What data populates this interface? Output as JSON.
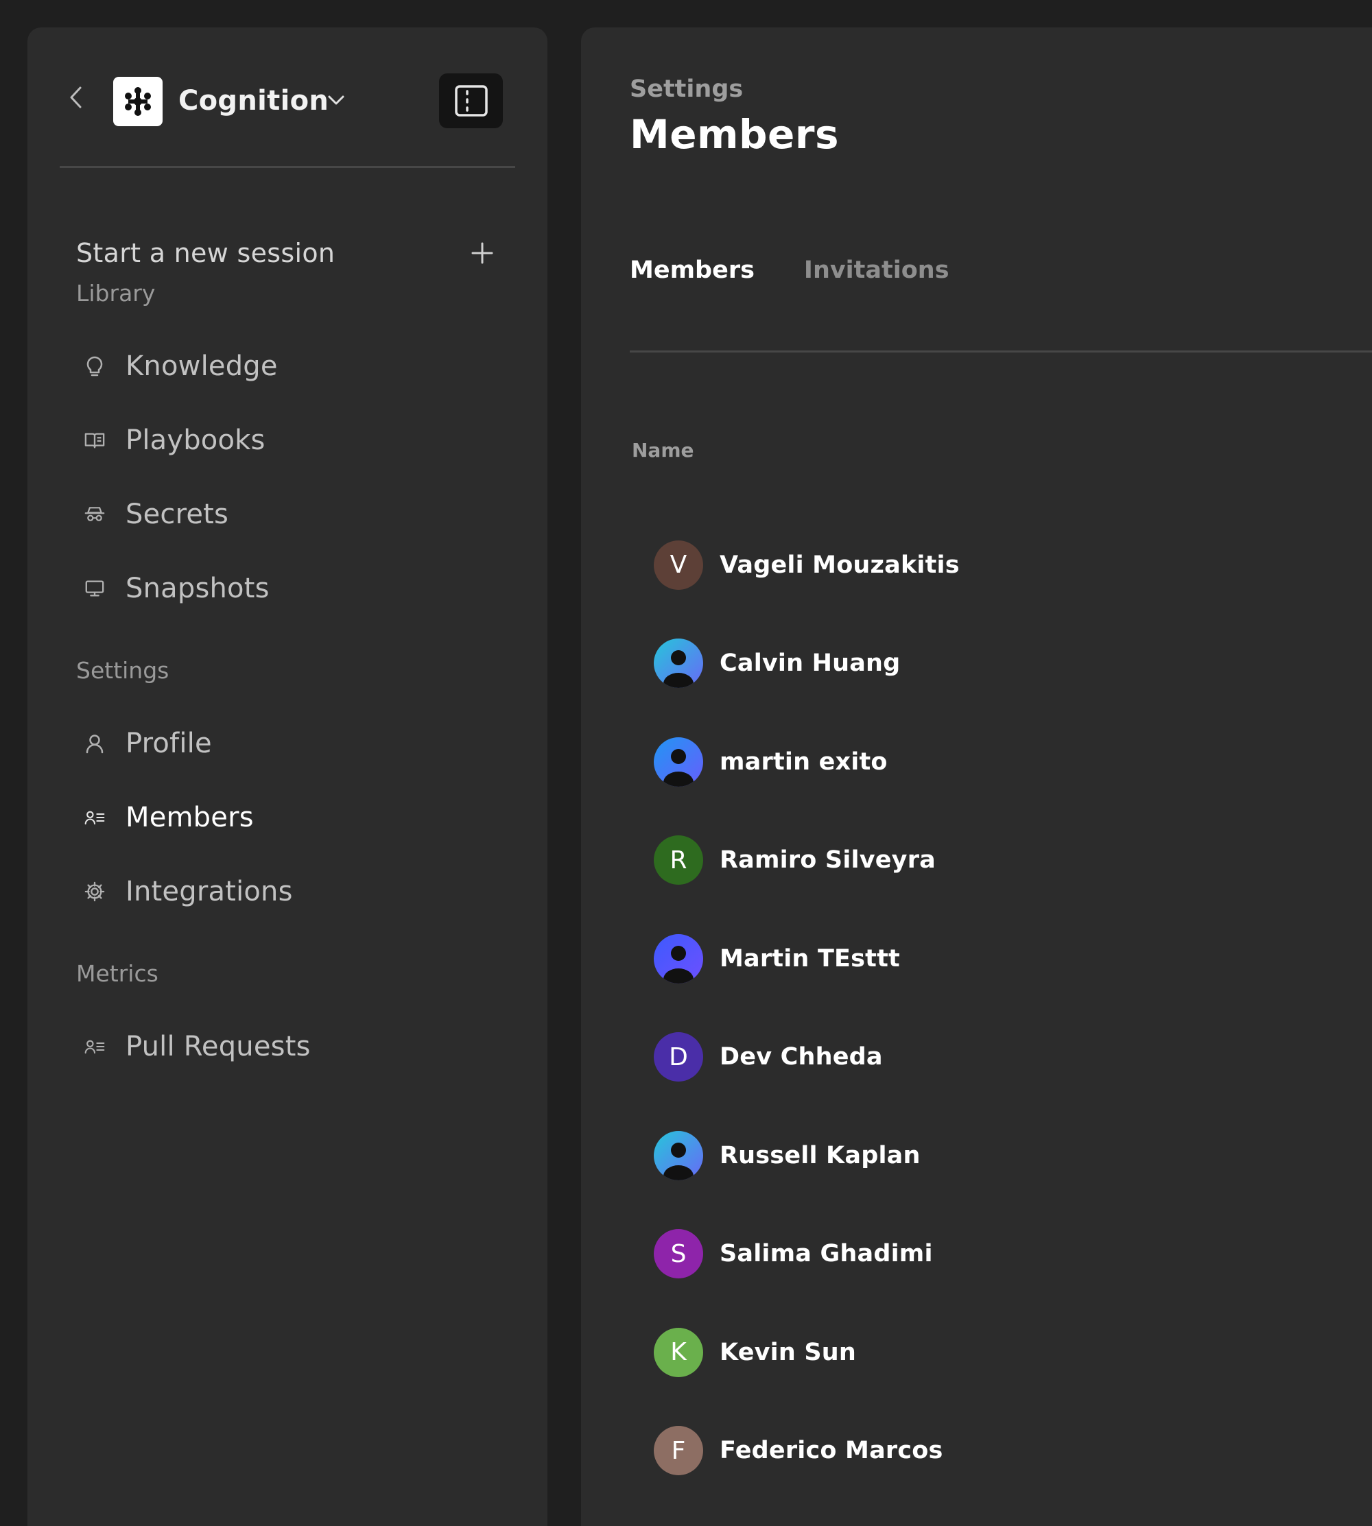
{
  "sidebar": {
    "org_name": "Cognition",
    "new_session_label": "Start a new session",
    "sections": {
      "library": "Library",
      "settings": "Settings",
      "metrics": "Metrics"
    },
    "library_items": [
      {
        "label": "Knowledge",
        "icon": "lightbulb-icon"
      },
      {
        "label": "Playbooks",
        "icon": "book-icon"
      },
      {
        "label": "Secrets",
        "icon": "incognito-icon"
      },
      {
        "label": "Snapshots",
        "icon": "monitor-icon"
      }
    ],
    "settings_items": [
      {
        "label": "Profile",
        "icon": "user-icon"
      },
      {
        "label": "Members",
        "icon": "members-icon",
        "active": true
      },
      {
        "label": "Integrations",
        "icon": "gear-icon"
      }
    ],
    "metrics_items": [
      {
        "label": "Pull Requests",
        "icon": "members-icon"
      }
    ]
  },
  "main": {
    "breadcrumb": "Settings",
    "title": "Members",
    "tabs": [
      {
        "label": "Members",
        "active": true
      },
      {
        "label": "Invitations",
        "active": false
      }
    ],
    "column_header": "Name",
    "members": [
      {
        "name": "Vageli Mouzakitis",
        "initial": "V",
        "color": "#5d4037",
        "avatar_type": "initial"
      },
      {
        "name": "Calvin Huang",
        "initial": "",
        "color": "#26c6da",
        "avatar_type": "photo"
      },
      {
        "name": "martin exito",
        "initial": "",
        "color": "#2196f3",
        "avatar_type": "photo"
      },
      {
        "name": "Ramiro Silveyra",
        "initial": "R",
        "color": "#2e6b1f",
        "avatar_type": "initial"
      },
      {
        "name": "Martin TEsttt",
        "initial": "",
        "color": "#3d5afe",
        "avatar_type": "photo"
      },
      {
        "name": "Dev Chheda",
        "initial": "D",
        "color": "#4a2ea8",
        "avatar_type": "initial"
      },
      {
        "name": "Russell Kaplan",
        "initial": "",
        "color": "#26c6da",
        "avatar_type": "photo"
      },
      {
        "name": "Salima Ghadimi",
        "initial": "S",
        "color": "#8e24aa",
        "avatar_type": "initial"
      },
      {
        "name": "Kevin Sun",
        "initial": "K",
        "color": "#6ab04c",
        "avatar_type": "initial"
      },
      {
        "name": "Federico Marcos",
        "initial": "F",
        "color": "#8d6e63",
        "avatar_type": "initial"
      }
    ]
  }
}
